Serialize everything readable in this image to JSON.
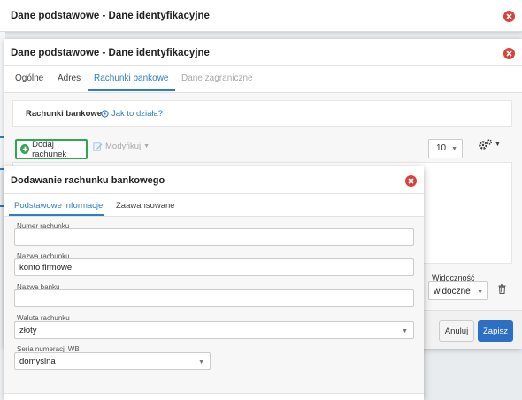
{
  "background_window": {
    "title": "Dane podstawowe - Dane identyfikacyjne"
  },
  "main_window": {
    "title": "Dane podstawowe - Dane identyfikacyjne",
    "tabs": [
      {
        "label": "Ogólne",
        "state": "normal"
      },
      {
        "label": "Adres",
        "state": "normal"
      },
      {
        "label": "Rachunki bankowe",
        "state": "active"
      },
      {
        "label": "Dane zagraniczne",
        "state": "disabled"
      }
    ],
    "section_label": "Rachunki bankowe",
    "help_link": "Jak to działa?",
    "toolbar": {
      "add_label": "Dodaj rachunek",
      "modify_label": "Modyfikuj",
      "page_size": "10"
    },
    "visibility": {
      "label": "Widoczność",
      "value": "widoczne"
    },
    "footer": {
      "cancel_label": "Anuluj",
      "save_label": "Zapisz"
    }
  },
  "dialog": {
    "title": "Dodawanie rachunku bankowego",
    "tabs": [
      {
        "label": "Podstawowe informacje",
        "state": "active"
      },
      {
        "label": "Zaawansowane",
        "state": "normal"
      }
    ],
    "fields": {
      "account_number": {
        "label": "Numer rachunku",
        "value": ""
      },
      "account_name": {
        "label": "Nazwa rachunku",
        "value": "konto firmowe"
      },
      "bank_name": {
        "label": "Nazwa banku",
        "value": ""
      },
      "currency": {
        "label": "Waluta rachunku",
        "value": "złoty"
      },
      "numbering_series": {
        "label": "Seria numeracji WB",
        "value": "domyślna"
      }
    }
  },
  "colors": {
    "accent": "#2e7ec2",
    "close_red": "#d9413a",
    "add_green": "#2fa84f",
    "save_blue": "#2d6fc4"
  },
  "icons": [
    "close-icon",
    "info-circle-icon",
    "plus-circle-icon",
    "edit-icon",
    "caret-down-icon",
    "gears-icon",
    "trash-icon"
  ]
}
